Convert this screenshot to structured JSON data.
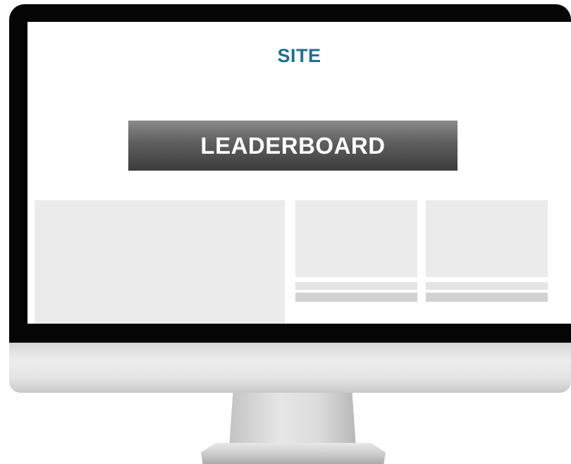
{
  "site": {
    "logo_text": "SITE",
    "logo_color": "#1d6f93"
  },
  "leaderboard": {
    "label": "LEADERBOARD"
  },
  "colors": {
    "bezel": "#050505",
    "placeholder": "#ebebeb",
    "placeholder_dark": "#d2d2d2"
  }
}
